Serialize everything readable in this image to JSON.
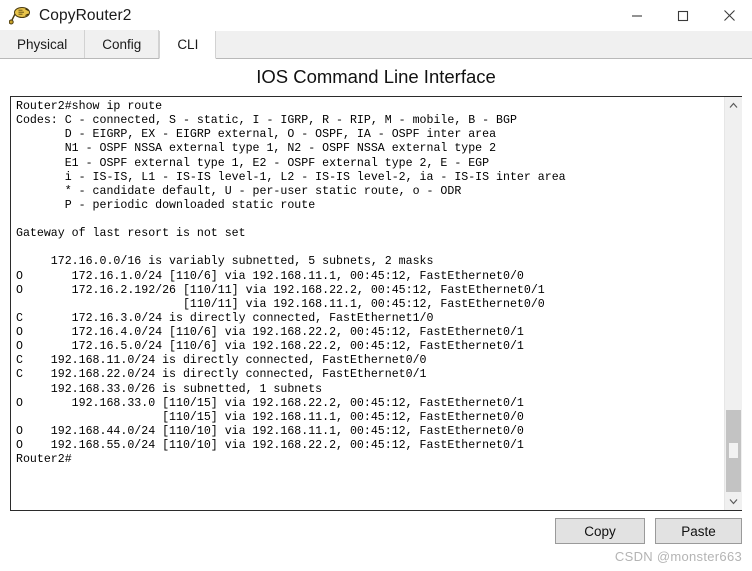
{
  "window": {
    "title": "CopyRouter2",
    "icon": "router-device-icon",
    "controls": [
      {
        "name": "minimize-button",
        "icon": "minimize-icon",
        "glyph": "—"
      },
      {
        "name": "maximize-button",
        "icon": "maximize-icon",
        "glyph": "□"
      },
      {
        "name": "close-button",
        "icon": "close-icon",
        "glyph": "✕"
      }
    ]
  },
  "tabs": [
    {
      "label": "Physical",
      "active": false
    },
    {
      "label": "Config",
      "active": false
    },
    {
      "label": "CLI",
      "active": true
    }
  ],
  "panel": {
    "heading": "IOS Command Line Interface"
  },
  "terminal": {
    "prompt": "Router2#",
    "command": "show ip route",
    "lines": [
      "Router2#show ip route",
      "Codes: C - connected, S - static, I - IGRP, R - RIP, M - mobile, B - BGP",
      "       D - EIGRP, EX - EIGRP external, O - OSPF, IA - OSPF inter area",
      "       N1 - OSPF NSSA external type 1, N2 - OSPF NSSA external type 2",
      "       E1 - OSPF external type 1, E2 - OSPF external type 2, E - EGP",
      "       i - IS-IS, L1 - IS-IS level-1, L2 - IS-IS level-2, ia - IS-IS inter area",
      "       * - candidate default, U - per-user static route, o - ODR",
      "       P - periodic downloaded static route",
      "",
      "Gateway of last resort is not set",
      "",
      "     172.16.0.0/16 is variably subnetted, 5 subnets, 2 masks",
      "O       172.16.1.0/24 [110/6] via 192.168.11.1, 00:45:12, FastEthernet0/0",
      "O       172.16.2.192/26 [110/11] via 192.168.22.2, 00:45:12, FastEthernet0/1",
      "                        [110/11] via 192.168.11.1, 00:45:12, FastEthernet0/0",
      "C       172.16.3.0/24 is directly connected, FastEthernet1/0",
      "O       172.16.4.0/24 [110/6] via 192.168.22.2, 00:45:12, FastEthernet0/1",
      "O       172.16.5.0/24 [110/6] via 192.168.22.2, 00:45:12, FastEthernet0/1",
      "C    192.168.11.0/24 is directly connected, FastEthernet0/0",
      "C    192.168.22.0/24 is directly connected, FastEthernet0/1",
      "     192.168.33.0/26 is subnetted, 1 subnets",
      "O       192.168.33.0 [110/15] via 192.168.22.2, 00:45:12, FastEthernet0/1",
      "                     [110/15] via 192.168.11.1, 00:45:12, FastEthernet0/0",
      "O    192.168.44.0/24 [110/10] via 192.168.11.1, 00:45:12, FastEthernet0/0",
      "O    192.168.55.0/24 [110/10] via 192.168.22.2, 00:45:12, FastEthernet0/1",
      "Router2#"
    ]
  },
  "scrollbar": {
    "up_icon": "chevron-up-icon",
    "down_icon": "chevron-down-icon",
    "up_glyph": "⌃",
    "down_glyph": "⌄"
  },
  "buttons": {
    "copy_label": "Copy",
    "paste_label": "Paste"
  },
  "watermark": {
    "text": "CSDN @monster663"
  },
  "colors": {
    "window_bg": "#ffffff",
    "tabbar_bg": "#f0f0f0",
    "terminal_bg": "#ffffff",
    "terminal_fg": "#000000",
    "button_bg": "#e2e2e2",
    "scroll_thumb": "#c3c3c3",
    "watermark_fg": "#b4b4b4"
  }
}
